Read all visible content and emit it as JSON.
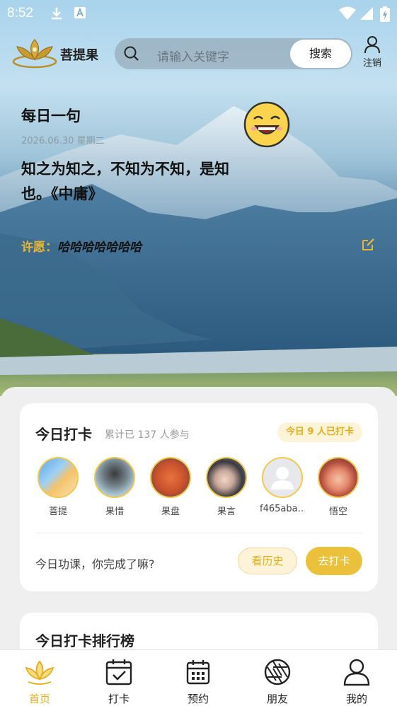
{
  "status_bar": {
    "time": "8:52"
  },
  "header": {
    "brand": "菩提果",
    "search_placeholder": "请输入关键字",
    "search_button": "搜索",
    "logout_label": "注销"
  },
  "daily": {
    "title": "每日一句",
    "date": "2026.06.30 星期二",
    "quote": "知之为知之，不知为不知，是知也。《中庸》",
    "wish_label": "许愿：",
    "wish_text": "哈哈哈哈哈哈哈"
  },
  "checkin_card": {
    "title": "今日打卡",
    "subtitle": "累计已 137 人参与",
    "badge": "今日 9 人已打卡",
    "users": [
      {
        "name": "菩提"
      },
      {
        "name": "果惜"
      },
      {
        "name": "果盘"
      },
      {
        "name": "果言"
      },
      {
        "name": "f465aba…"
      },
      {
        "name": "悟空"
      }
    ],
    "prompt": "今日功课，你完成了嘛?",
    "history_button": "看历史",
    "checkin_button": "去打卡"
  },
  "ranking_card": {
    "title": "今日打卡排行榜"
  },
  "bottom_nav": {
    "items": [
      {
        "label": "首页",
        "icon": "lotus-icon"
      },
      {
        "label": "打卡",
        "icon": "calendar-check-icon"
      },
      {
        "label": "预约",
        "icon": "calendar-icon"
      },
      {
        "label": "朋友",
        "icon": "aperture-icon"
      },
      {
        "label": "我的",
        "icon": "user-icon"
      }
    ]
  },
  "colors": {
    "accent": "#e7ac17",
    "accent_fill": "#ebc03b",
    "badge_bg": "#fdf3d8"
  }
}
